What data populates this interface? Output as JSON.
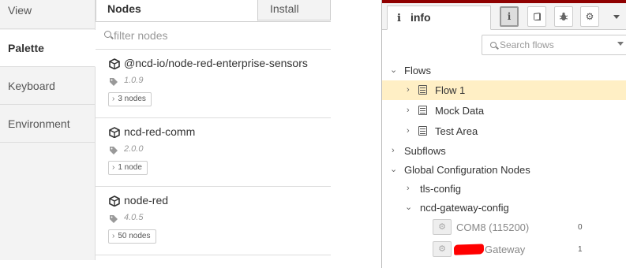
{
  "settings": {
    "tabs": [
      {
        "label": "View"
      },
      {
        "label": "Palette"
      },
      {
        "label": "Keyboard"
      },
      {
        "label": "Environment"
      }
    ],
    "palette_tabs": {
      "nodes": "Nodes",
      "install": "Install"
    },
    "filter_placeholder": "filter nodes",
    "packages": [
      {
        "name": "@ncd-io/node-red-enterprise-sensors",
        "version": "1.0.9",
        "count": "3 nodes"
      },
      {
        "name": "ncd-red-comm",
        "version": "2.0.0",
        "count": "1 node"
      },
      {
        "name": "node-red",
        "version": "4.0.5",
        "count": "50 nodes"
      }
    ]
  },
  "sidebar": {
    "tab_icon": "info-icon",
    "tab_label": "info",
    "buttons": [
      "info-icon",
      "book-icon",
      "bug-icon",
      "gear-icon",
      "chevron-down-icon"
    ],
    "search_placeholder": "Search flows",
    "tree": {
      "flows_label": "Flows",
      "flows": [
        "Flow 1",
        "Mock Data",
        "Test Area"
      ],
      "subflows_label": "Subflows",
      "global_label": "Global Configuration Nodes",
      "configs": [
        {
          "label": "tls-config",
          "items": []
        },
        {
          "label": "ncd-gateway-config",
          "items": [
            {
              "label": "COM8 (115200)",
              "count": "0"
            },
            {
              "label": "Gateway",
              "count": "1"
            }
          ]
        }
      ]
    },
    "colors": {
      "header_red": "#8f0000",
      "highlight": "#ffefc5",
      "redaction": "#ff0000"
    }
  }
}
